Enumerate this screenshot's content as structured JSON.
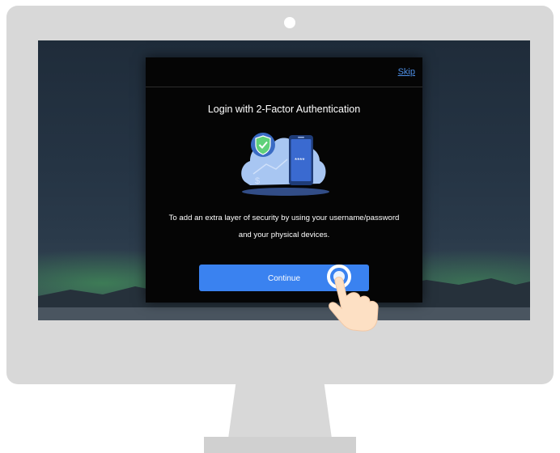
{
  "dialog": {
    "skip_label": "Skip",
    "title": "Login with 2-Factor Authentication",
    "description_line1": "To add an extra layer of security by using your username/password",
    "description_line2": "and your physical devices.",
    "continue_label": "Continue"
  },
  "illustration": {
    "password_mask": "****",
    "dollar_sign": "$"
  },
  "colors": {
    "accent": "#3a82f0",
    "link": "#4d8fe6",
    "dialog_background": "#050505",
    "monitor_frame": "#d8d8d8"
  },
  "icons": [
    "shield-check-icon",
    "smartphone-icon",
    "cloud-icon",
    "hand-pointer-icon"
  ]
}
